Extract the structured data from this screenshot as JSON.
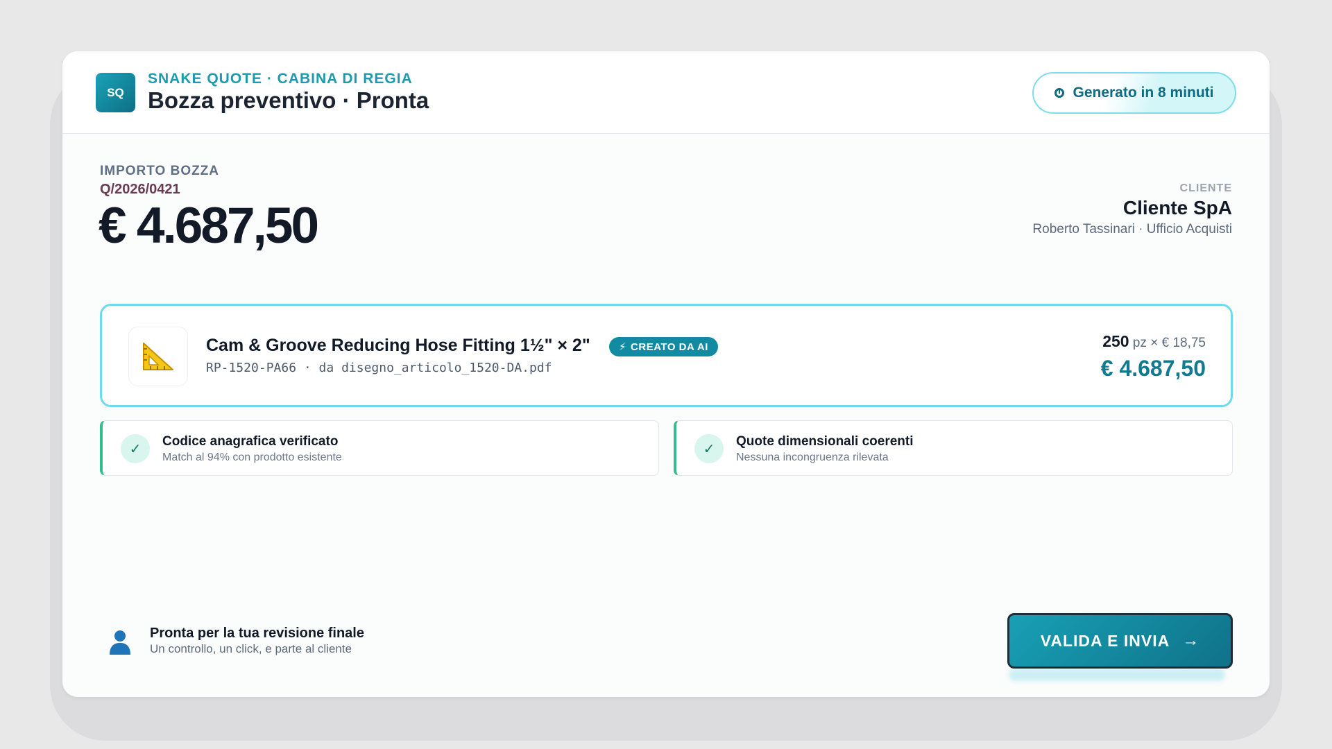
{
  "header": {
    "logo_text": "SQ",
    "eyebrow": "SNAKE QUOTE · CABINA DI REGIA",
    "title": "Bozza preventivo · Pronta",
    "generated_badge": "Generato in 8 minuti",
    "generated_icon": "timer-icon"
  },
  "summary": {
    "amount_label": "IMPORTO BOZZA",
    "quote_id": "Q/2026/0421",
    "amount": "€ 4.687,50"
  },
  "client": {
    "label": "CLIENTE",
    "name": "Cliente SpA",
    "contact": "Roberto Tassinari · Ufficio Acquisti"
  },
  "item": {
    "icon": "triangular-ruler-icon",
    "name": "Cam & Groove Reducing Hose Fitting 1½\" × 2\"",
    "ai_badge": "CREATO DA AI",
    "ai_badge_icon": "lightning-icon",
    "code_line": "RP-1520-PA66 · da disegno_articolo_1520-DA.pdf",
    "quantity": "250",
    "unit_price_text": "pz × € 18,75",
    "line_total": "€ 4.687,50"
  },
  "checks": [
    {
      "title": "Codice anagrafica verificato",
      "subtitle": "Match al 94% con prodotto esistente"
    },
    {
      "title": "Quote dimensionali coerenti",
      "subtitle": "Nessuna incongruenza rilevata"
    }
  ],
  "footer": {
    "ready_title": "Pronta per la tua revisione finale",
    "ready_subtitle": "Un controllo, un click, e parte al cliente",
    "ready_icon": "user-icon",
    "cta_label": "VALIDA E INVIA",
    "cta_arrow": "→"
  },
  "colors": {
    "accent": "#1a9bb1",
    "accent_dark": "#0f7289",
    "success": "#34bb8e",
    "item_border": "#6ddbee"
  }
}
